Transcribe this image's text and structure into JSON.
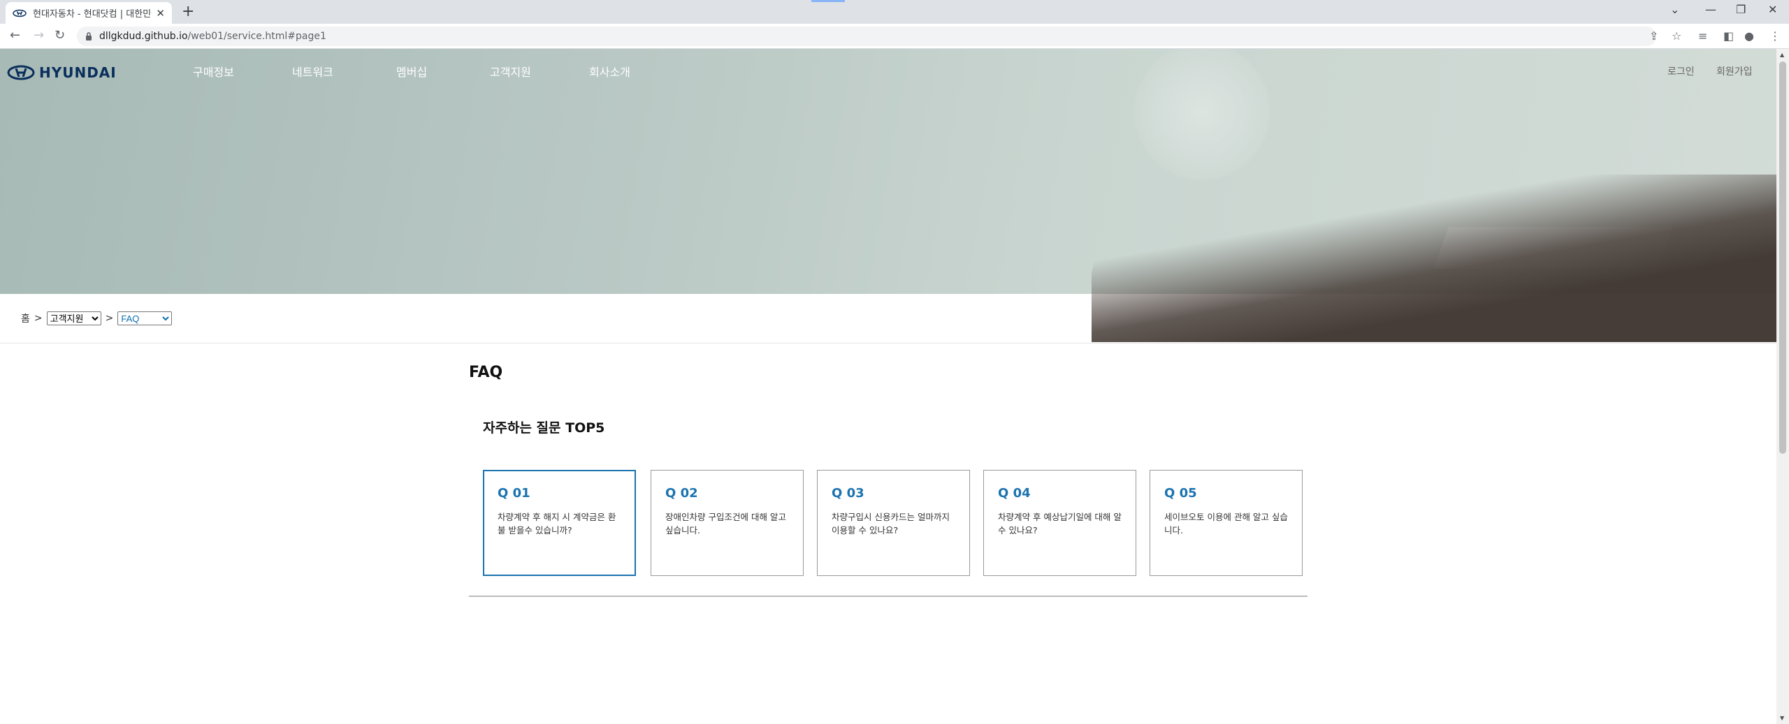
{
  "browser": {
    "tab_title": "현대자동차 - 현대닷컴 | 대한민국",
    "url_domain": "dllgkdud.github.io",
    "url_path": "/web01/service.html#page1"
  },
  "header": {
    "logo_text": "HYUNDAI",
    "nav": [
      "구매정보",
      "네트워크",
      "멤버십",
      "고객지원",
      "회사소개"
    ],
    "login": "로그인",
    "signup": "회원가입"
  },
  "breadcrumb": {
    "home": "홈",
    "separator": ">",
    "category": "고객지원",
    "page": "FAQ"
  },
  "main": {
    "title": "FAQ",
    "subtitle": "자주하는 질문 TOP5",
    "cards": [
      {
        "q": "Q 01",
        "text": "차량계약 후 해지 시 계약금은 환불 받을수 있습니까?"
      },
      {
        "q": "Q 02",
        "text": "장애인차량 구입조건에 대해 알고 싶습니다."
      },
      {
        "q": "Q 03",
        "text": "차량구입시 신용카드는 얼마까지 이용할 수 있나요?"
      },
      {
        "q": "Q 04",
        "text": "차량계약 후 예상납기일에 대해 알 수 있나요?"
      },
      {
        "q": "Q 05",
        "text": "세이브오토 이용에 관해 알고 싶습니다."
      }
    ]
  },
  "colors": {
    "accent": "#1a73b0",
    "logo": "#0a2e5c"
  }
}
